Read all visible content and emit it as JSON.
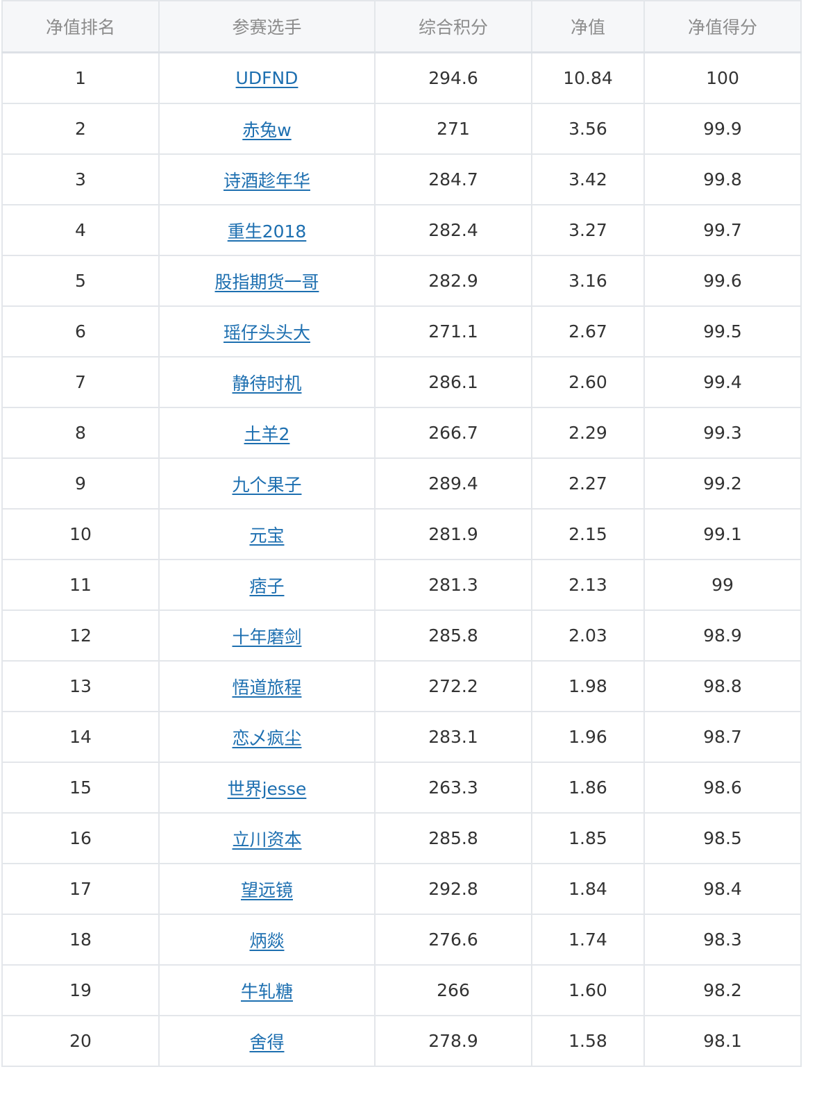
{
  "table": {
    "headers": [
      "净值排名",
      "参赛选手",
      "综合积分",
      "净值",
      "净值得分"
    ],
    "rows": [
      {
        "rank": "1",
        "player": "UDFND",
        "score": "294.6",
        "nav": "10.84",
        "nav_score": "100"
      },
      {
        "rank": "2",
        "player": "赤兔w",
        "score": "271",
        "nav": "3.56",
        "nav_score": "99.9"
      },
      {
        "rank": "3",
        "player": "诗酒趁年华",
        "score": "284.7",
        "nav": "3.42",
        "nav_score": "99.8"
      },
      {
        "rank": "4",
        "player": "重生2018",
        "score": "282.4",
        "nav": "3.27",
        "nav_score": "99.7"
      },
      {
        "rank": "5",
        "player": "股指期货一哥",
        "score": "282.9",
        "nav": "3.16",
        "nav_score": "99.6"
      },
      {
        "rank": "6",
        "player": "瑶仔头头大",
        "score": "271.1",
        "nav": "2.67",
        "nav_score": "99.5"
      },
      {
        "rank": "7",
        "player": "静待时机",
        "score": "286.1",
        "nav": "2.60",
        "nav_score": "99.4"
      },
      {
        "rank": "8",
        "player": "土羊2",
        "score": "266.7",
        "nav": "2.29",
        "nav_score": "99.3"
      },
      {
        "rank": "9",
        "player": "九个果子",
        "score": "289.4",
        "nav": "2.27",
        "nav_score": "99.2"
      },
      {
        "rank": "10",
        "player": "元宝",
        "score": "281.9",
        "nav": "2.15",
        "nav_score": "99.1"
      },
      {
        "rank": "11",
        "player": "痞子",
        "score": "281.3",
        "nav": "2.13",
        "nav_score": "99"
      },
      {
        "rank": "12",
        "player": "十年磨剑",
        "score": "285.8",
        "nav": "2.03",
        "nav_score": "98.9"
      },
      {
        "rank": "13",
        "player": "悟道旅程",
        "score": "272.2",
        "nav": "1.98",
        "nav_score": "98.8"
      },
      {
        "rank": "14",
        "player": "恋乄疯尘",
        "score": "283.1",
        "nav": "1.96",
        "nav_score": "98.7"
      },
      {
        "rank": "15",
        "player": "世界jesse",
        "score": "263.3",
        "nav": "1.86",
        "nav_score": "98.6"
      },
      {
        "rank": "16",
        "player": "立川资本",
        "score": "285.8",
        "nav": "1.85",
        "nav_score": "98.5"
      },
      {
        "rank": "17",
        "player": "望远镜",
        "score": "292.8",
        "nav": "1.84",
        "nav_score": "98.4"
      },
      {
        "rank": "18",
        "player": "炳燚",
        "score": "276.6",
        "nav": "1.74",
        "nav_score": "98.3"
      },
      {
        "rank": "19",
        "player": "牛轧糖",
        "score": "266",
        "nav": "1.60",
        "nav_score": "98.2"
      },
      {
        "rank": "20",
        "player": "舍得",
        "score": "278.9",
        "nav": "1.58",
        "nav_score": "98.1"
      }
    ]
  }
}
